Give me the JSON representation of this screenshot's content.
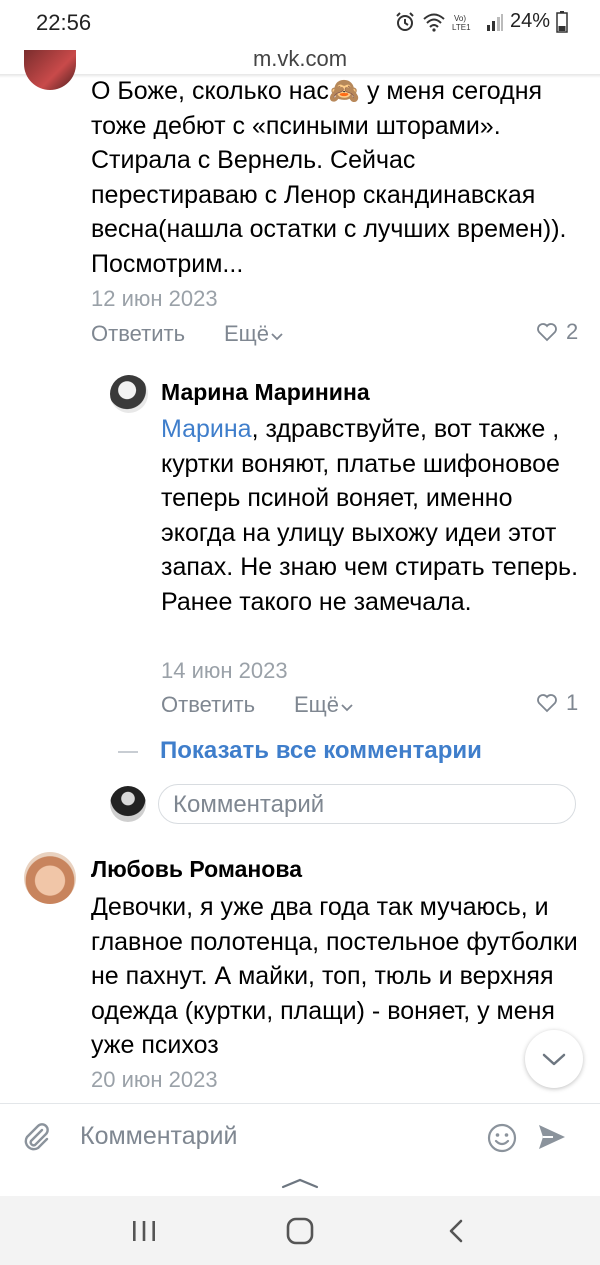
{
  "status": {
    "time": "22:56",
    "battery": "24%"
  },
  "browser": {
    "url": "m.vk.com"
  },
  "comments": [
    {
      "text": "О Боже, сколько нас🙈 у меня сегодня тоже дебют с «псиными шторами». Стирала с Вернель. Сейчас перестираваю с Ленор скандинавская весна(нашла остатки с лучших времен)). Посмотрим...",
      "date": "12 июн 2023",
      "reply": "Ответить",
      "more": "Ещё",
      "likes": "2"
    },
    {
      "author": "Марина Маринина",
      "mention": "Марина",
      "text": ", здравствуйте, вот также , куртки воняют, платье шифоновое теперь псиной воняет, именно экогда на улицу выхожу идеи этот запах. Не знаю чем стирать теперь. Ранее такого не замечала.",
      "date": "14 июн 2023",
      "reply": "Ответить",
      "more": "Ещё",
      "likes": "1"
    },
    {
      "author": "Любовь Романова",
      "text": "Девочки, я уже два года так мучаюсь, и главное полотенца, постельное футболки не пахнут. А майки, топ, тюль и верхняя одежда (куртки, плащи) - воняет, у меня уже психоз",
      "date": "20 июн 2023"
    }
  ],
  "thread": {
    "show_all": "Показать все комментарии",
    "placeholder": "Комментарий"
  },
  "bottom": {
    "placeholder": "Комментарий"
  },
  "colors": {
    "accent": "#3f7ecb",
    "muted": "#7f8791",
    "date": "#9aa1a8"
  },
  "icons": [
    "alarm-icon",
    "wifi-icon",
    "volte-icon",
    "signal-icon",
    "battery-icon",
    "attach-icon",
    "emoji-icon",
    "send-icon",
    "chevron-down-icon",
    "heart-icon",
    "recent-apps-icon",
    "home-icon",
    "back-icon"
  ]
}
